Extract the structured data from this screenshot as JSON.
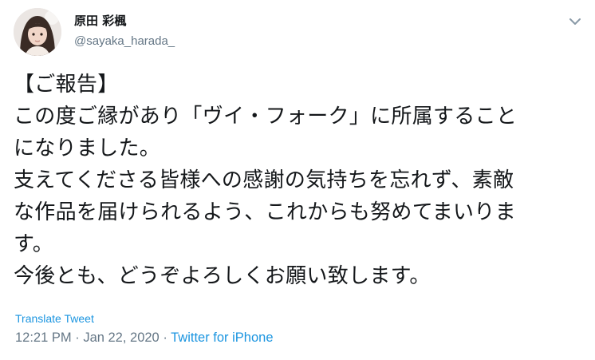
{
  "author": {
    "display_name": "原田 彩楓",
    "handle": "@sayaka_harada_"
  },
  "tweet": {
    "lines": [
      "【ご報告】",
      "この度ご縁があり「ヴイ・フォーク」に所属すること",
      "になりました。",
      "支えてくださる皆様への感謝の気持ちを忘れず、素敵",
      "な作品を届けられるよう、これからも努めてまいりま",
      "す。",
      "今後とも、どうぞよろしくお願い致します。"
    ],
    "translate_label": "Translate Tweet",
    "time": "12:21 PM",
    "separator": "·",
    "date": "Jan 22, 2020",
    "source": "Twitter for iPhone"
  },
  "icons": {
    "caret": "chevron-down-icon",
    "avatar": "profile-photo"
  },
  "colors": {
    "text": "#14171a",
    "secondary": "#657786",
    "link": "#1b95e0"
  }
}
